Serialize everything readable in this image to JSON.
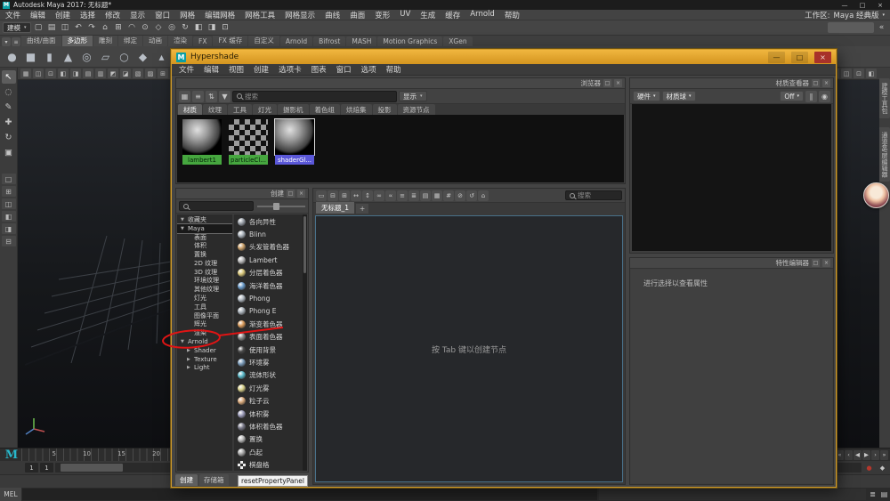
{
  "window": {
    "app_initial": "M",
    "title": "Autodesk Maya 2017: 无标题*",
    "minimize": "—",
    "maximize": "□",
    "close": "×"
  },
  "menubar": {
    "items": [
      "文件",
      "编辑",
      "创建",
      "选择",
      "修改",
      "显示",
      "窗口",
      "网格",
      "编辑网格",
      "网格工具",
      "网格显示",
      "曲线",
      "曲面",
      "变形",
      "UV",
      "生成",
      "缓存",
      "Arnold",
      "帮助"
    ],
    "workspace_label": "工作区:",
    "workspace_value": "Maya 经典版"
  },
  "statusline": {
    "menuset": "建模",
    "icons": [
      {
        "name": "new-scene-icon",
        "glyph": "▢"
      },
      {
        "name": "open-scene-icon",
        "glyph": "▤"
      },
      {
        "name": "save-scene-icon",
        "glyph": "◫"
      },
      {
        "name": "undo-icon",
        "glyph": "↶"
      },
      {
        "name": "redo-icon",
        "glyph": "↷"
      },
      {
        "name": "selection-mask-icon",
        "glyph": "⌂"
      },
      {
        "name": "snap-to-grid-icon",
        "glyph": "⊞"
      },
      {
        "name": "snap-to-curve-icon",
        "glyph": "◠"
      },
      {
        "name": "snap-to-point-icon",
        "glyph": "⊙"
      },
      {
        "name": "snap-to-plane-icon",
        "glyph": "◇"
      },
      {
        "name": "make-live-icon",
        "glyph": "◎"
      },
      {
        "name": "construction-history-icon",
        "glyph": "↻"
      },
      {
        "name": "render-current-frame-icon",
        "glyph": "◧"
      },
      {
        "name": "ipr-render-icon",
        "glyph": "◨"
      },
      {
        "name": "render-settings-icon",
        "glyph": "⊡"
      }
    ]
  },
  "shelf": {
    "left_icons": [
      {
        "name": "shelf-tab-selector-icon",
        "glyph": "▾"
      },
      {
        "name": "shelf-menu-icon",
        "glyph": "≡"
      }
    ],
    "tabs": [
      {
        "label": "曲线/曲面"
      },
      {
        "label": "多边形",
        "active": true
      },
      {
        "label": "雕刻"
      },
      {
        "label": "绑定"
      },
      {
        "label": "动画"
      },
      {
        "label": "渲染"
      },
      {
        "label": "FX"
      },
      {
        "label": "FX 缓存"
      },
      {
        "label": "自定义"
      },
      {
        "label": "Arnold"
      },
      {
        "label": "Bifrost"
      },
      {
        "label": "MASH"
      },
      {
        "label": "Motion Graphics"
      },
      {
        "label": "XGen"
      }
    ],
    "icons": [
      {
        "name": "poly-sphere-icon",
        "glyph": "●",
        "color": "#b8bec6"
      },
      {
        "name": "poly-cube-icon",
        "glyph": "■",
        "color": "#b8bec6"
      },
      {
        "name": "poly-cylinder-icon",
        "glyph": "▮",
        "color": "#b8bec6"
      },
      {
        "name": "poly-cone-icon",
        "glyph": "▲",
        "color": "#b8bec6"
      },
      {
        "name": "poly-torus-icon",
        "glyph": "◎",
        "color": "#b8bec6"
      },
      {
        "name": "poly-plane-icon",
        "glyph": "▱",
        "color": "#b8bec6"
      },
      {
        "name": "poly-disc-icon",
        "glyph": "○",
        "color": "#b8bec6"
      },
      {
        "name": "poly-platonic-icon",
        "glyph": "◆",
        "color": "#b8bec6"
      },
      {
        "name": "poly-pyramid-icon",
        "glyph": "▴",
        "color": "#b8bec6"
      },
      {
        "name": "poly-pipe-icon",
        "glyph": "◉",
        "color": "#b8bec6"
      },
      {
        "name": "poly-helix-icon",
        "glyph": "∿",
        "color": "#b8bec6"
      },
      {
        "name": "poly-gear-icon",
        "glyph": "✱",
        "color": "#b8bec6"
      },
      {
        "name": "boolean-icon",
        "glyph": "◐",
        "color": "#84b7e8"
      },
      {
        "name": "combine-icon",
        "glyph": "◑",
        "color": "#e8b784"
      },
      {
        "name": "smooth-icon",
        "glyph": "◒",
        "color": "#9fd68d"
      },
      {
        "name": "mirror-icon",
        "glyph": "◓",
        "color": "#d68d9f"
      },
      {
        "name": "extrude-icon",
        "glyph": "↑",
        "color": "#d6cf8d"
      },
      {
        "name": "bevel-icon",
        "glyph": "◆",
        "color": "#8dcfd6"
      }
    ]
  },
  "toolbox": {
    "tools": [
      {
        "name": "select-tool",
        "glyph": "↖",
        "active": true
      },
      {
        "name": "lasso-tool",
        "glyph": "◌"
      },
      {
        "name": "paint-select-tool",
        "glyph": "✎"
      },
      {
        "name": "move-tool",
        "glyph": "✚"
      },
      {
        "name": "rotate-tool",
        "glyph": "↻"
      },
      {
        "name": "scale-tool",
        "glyph": "▣"
      }
    ],
    "layouts": [
      {
        "name": "layout-single-pane-button",
        "glyph": "□"
      },
      {
        "name": "layout-four-pane-button",
        "glyph": "⊞"
      },
      {
        "name": "layout-two-pane-button",
        "glyph": "◫"
      },
      {
        "name": "layout-outliner-button",
        "glyph": "◧"
      },
      {
        "name": "layout-hypershade-button",
        "glyph": "◨"
      },
      {
        "name": "layout-uv-button",
        "glyph": "⊟"
      }
    ]
  },
  "viewport": {
    "toolbar_icons": [
      "▦",
      "◫",
      "⊡",
      "◧",
      "◨",
      "▤",
      "▥",
      "◩",
      "◪",
      "▧",
      "▨",
      "⊞"
    ],
    "toolbar_icons_right": [
      "▦",
      "◫",
      "⊡",
      "◧"
    ]
  },
  "side_tabs": [
    {
      "label": "建模工具包"
    },
    {
      "label": "通道盒/层编辑器"
    }
  ],
  "timeline": {
    "logo": "M",
    "tick_labels": [
      "5",
      "10",
      "15",
      "20"
    ],
    "playback": [
      {
        "name": "go-to-start-button",
        "glyph": "«"
      },
      {
        "name": "step-back-button",
        "glyph": "‹"
      },
      {
        "name": "play-backwards-button",
        "glyph": "◀"
      },
      {
        "name": "play-button",
        "glyph": "▶"
      },
      {
        "name": "step-forward-button",
        "glyph": "›"
      },
      {
        "name": "go-to-end-button",
        "glyph": "»"
      }
    ],
    "range": {
      "start": "1",
      "start2": "1"
    },
    "range_icons": [
      {
        "name": "auto-keyframe-icon",
        "glyph": "●",
        "color": "#b5372c"
      },
      {
        "name": "animation-preferences-icon",
        "glyph": "◆"
      }
    ]
  },
  "command_line": {
    "label": "MEL"
  },
  "bottom_icons": [
    {
      "name": "script-editor-icon",
      "glyph": "≣"
    },
    {
      "name": "command-line-toggle-icon",
      "glyph": "▤"
    }
  ],
  "hypershade": {
    "app_initial": "M",
    "title": "Hypershade",
    "minimize": "—",
    "maximize": "□",
    "close": "×",
    "menus": [
      "文件",
      "编辑",
      "视图",
      "创建",
      "选项卡",
      "图表",
      "窗口",
      "选项",
      "帮助"
    ],
    "panel_float": "□",
    "panel_close": "×",
    "browser": {
      "title": "浏览器",
      "toolbar_icons": [
        {
          "name": "swatch-view-icon",
          "glyph": "▦"
        },
        {
          "name": "list-view-icon",
          "glyph": "≡"
        },
        {
          "name": "sort-icon",
          "glyph": "⇅"
        },
        {
          "name": "filter-icon",
          "glyph": "▼"
        }
      ],
      "search_placeholder": "搜索",
      "display_button": "显示",
      "tabs": [
        {
          "label": "材质",
          "active": true
        },
        {
          "label": "纹理"
        },
        {
          "label": "工具"
        },
        {
          "label": "灯光"
        },
        {
          "label": "摄影机"
        },
        {
          "label": "着色组"
        },
        {
          "label": "烘焙集"
        },
        {
          "label": "投影"
        },
        {
          "label": "资源节点"
        }
      ],
      "swatches": [
        {
          "name": "lambert1",
          "type": "sphere",
          "label_color": "#46a73f"
        },
        {
          "name": "particleCl...",
          "type": "checker",
          "label_color": "#46a73f"
        },
        {
          "name": "shaderGl...",
          "type": "sphere",
          "label_color": "#5a57d8",
          "selected": true
        }
      ]
    },
    "create": {
      "title": "创建",
      "search_placeholder": "",
      "categories": [
        {
          "label": "收藏夹",
          "arrow": "▼"
        },
        {
          "label": "Maya",
          "arrow": "▼",
          "active": true
        },
        {
          "label": "表面",
          "indent": 1
        },
        {
          "label": "体积",
          "indent": 1
        },
        {
          "label": "置换",
          "indent": 1
        },
        {
          "label": "2D 纹理",
          "indent": 1
        },
        {
          "label": "3D 纹理",
          "indent": 1
        },
        {
          "label": "环境纹理",
          "indent": 1
        },
        {
          "label": "其他纹理",
          "indent": 1
        },
        {
          "label": "灯光",
          "indent": 1
        },
        {
          "label": "工具",
          "indent": 1
        },
        {
          "label": "图像平面",
          "indent": 1
        },
        {
          "label": "辉光",
          "indent": 1
        },
        {
          "label": "渲染",
          "indent": 1
        },
        {
          "label": "Arnold",
          "arrow": "▼",
          "annotated": true
        },
        {
          "label": "Shader",
          "arrow": "▶",
          "indent": 1
        },
        {
          "label": "Texture",
          "arrow": "▶",
          "indent": 1
        },
        {
          "label": "Light",
          "arrow": "▶",
          "indent": 1
        }
      ],
      "items": [
        {
          "label": "各向异性",
          "color": "#9aa0a8"
        },
        {
          "label": "Blinn",
          "color": "#aab2ba"
        },
        {
          "label": "头发管着色器",
          "color": "#caa06a"
        },
        {
          "label": "Lambert",
          "color": "#b8b8b8"
        },
        {
          "label": "分层着色器",
          "color": "#d8c77a"
        },
        {
          "label": "海洋着色器",
          "color": "#6a9ac8"
        },
        {
          "label": "Phong",
          "color": "#b0b8c0"
        },
        {
          "label": "Phong E",
          "color": "#a8b0b8"
        },
        {
          "label": "渐变着色器",
          "color": "#d89a5a"
        },
        {
          "label": "表面着色器",
          "color": "#8a8a8a"
        },
        {
          "label": "使用背景",
          "color": "#4a4a4a"
        },
        {
          "label": "环境雾",
          "color": "#7a9ab8"
        },
        {
          "label": "流体形状",
          "color": "#5ab8c8"
        },
        {
          "label": "灯光雾",
          "color": "#d8d08a"
        },
        {
          "label": "粒子云",
          "color": "#d8a87a"
        },
        {
          "label": "体积雾",
          "color": "#9a9ab8"
        },
        {
          "label": "体积着色器",
          "color": "#7a7a8a"
        },
        {
          "label": "置换",
          "color": "#b8b8b8"
        },
        {
          "label": "凸起",
          "color": "#a8a8a8"
        },
        {
          "label": "棋盘格",
          "type": "checker"
        }
      ],
      "tabs": [
        {
          "label": "创建",
          "active": true
        },
        {
          "label": "存储箱"
        }
      ],
      "tooltip": "resetPropertyPanel"
    },
    "work_area": {
      "toolbar_icons": [
        "▭",
        "⊟",
        "⊞",
        "↔",
        "↕",
        "∞",
        "∝",
        "≡",
        "≣",
        "▤",
        "▦",
        "#",
        "⊘",
        "↺",
        "⌂"
      ],
      "search_placeholder": "搜索",
      "tabs": [
        {
          "label": "无标题_1",
          "active": true
        }
      ],
      "new_tab": "+",
      "hint": "按 Tab 键以创建节点"
    },
    "material_viewer": {
      "title": "材质查看器",
      "renderer": "硬件",
      "geometry": "材质球",
      "environment": "Off",
      "icons": [
        {
          "name": "pause-icon",
          "glyph": "∥"
        },
        {
          "name": "snapshot-icon",
          "glyph": "◉"
        }
      ]
    },
    "property_editor": {
      "title": "特性编辑器",
      "hint": "进行选择以查看属性"
    }
  },
  "annotation": {
    "color": "#e01414"
  }
}
